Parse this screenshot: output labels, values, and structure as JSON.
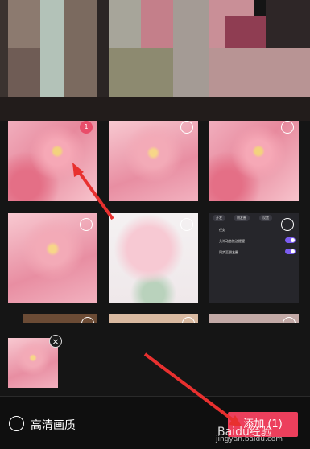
{
  "preview": {
    "pixel_colors": [
      "#7d6b63",
      "#b7a99c",
      "#a4b6a1",
      "#8f7770",
      "#d7a8a7",
      "#9b5b66",
      "#6f5e5a",
      "#c58c96",
      "#a05a6a",
      "#e2d5cd",
      "#6d8a6b",
      "#b68390"
    ]
  },
  "grid": {
    "selected_index_label": "1",
    "settings_card": {
      "pills": [
        "开发",
        "朋友圈",
        "设置"
      ],
      "rows": [
        "任务",
        "允许动态推送提醒",
        "同步至朋友圈"
      ]
    }
  },
  "selected_strip": {
    "remove_label": "×"
  },
  "bottom": {
    "hd_label": "高清画质",
    "add_button": "添加 (1)"
  },
  "watermark": {
    "brand": "Baidu经验",
    "url": "jingyan.baidu.com"
  },
  "colors": {
    "accent": "#ec3f5c",
    "toggle": "#7b5cf0",
    "arrow": "#e8302f"
  }
}
